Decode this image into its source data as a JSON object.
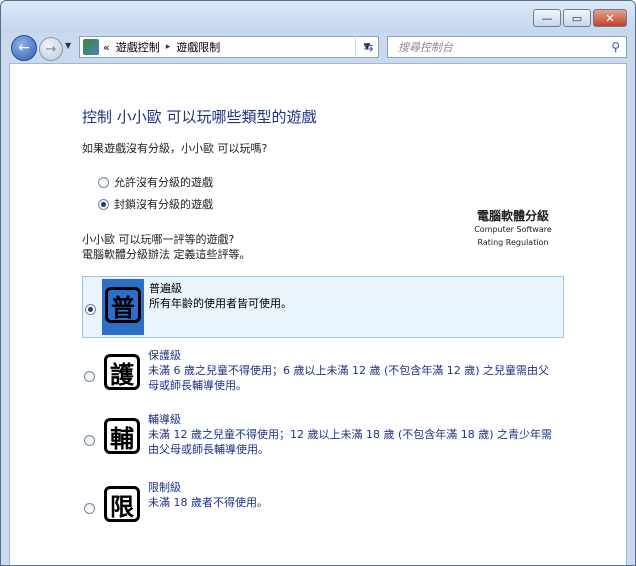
{
  "toolbar": {
    "breadcrumb_prefix": "«",
    "crumb1": "遊戲控制",
    "crumb_sep": "▸",
    "crumb2": "遊戲限制",
    "search_placeholder": "搜尋控制台"
  },
  "page": {
    "title": "控制 小小歐 可以玩哪些類型的遊戲",
    "question_unrated": "如果遊戲沒有分級，小小歐 可以玩嗎?",
    "option_allow": "允許沒有分級的遊戲",
    "option_block": "封鎖沒有分級的遊戲",
    "selected_option": "block",
    "rating_question_line1": "小小歐 可以玩哪一評等的遊戲?",
    "rating_question_line2": "電腦軟體分級辦法 定義這些評等。",
    "rating_system_zh": "電腦軟體分級",
    "rating_system_en1": "Computer Software",
    "rating_system_en2": "Rating Regulation"
  },
  "ratings": [
    {
      "glyph": "普",
      "name": "普遍級",
      "desc": "所有年齡的使用者皆可使用。",
      "selected": true
    },
    {
      "glyph": "護",
      "name": "保護級",
      "desc": "未滿 6 歲之兒童不得使用；6 歲以上未滿 12 歲 (不包含年滿 12 歲) 之兒童需由父母或師長輔導使用。",
      "selected": false
    },
    {
      "glyph": "輔",
      "name": "輔導級",
      "desc": "未滿 12 歲之兒童不得使用；12 歲以上未滿 18 歲 (不包含年滿 18 歲) 之青少年需由父母或師長輔導使用。",
      "selected": false
    },
    {
      "glyph": "限",
      "name": "限制級",
      "desc": "未滿 18 歲者不得使用。",
      "selected": false
    }
  ]
}
